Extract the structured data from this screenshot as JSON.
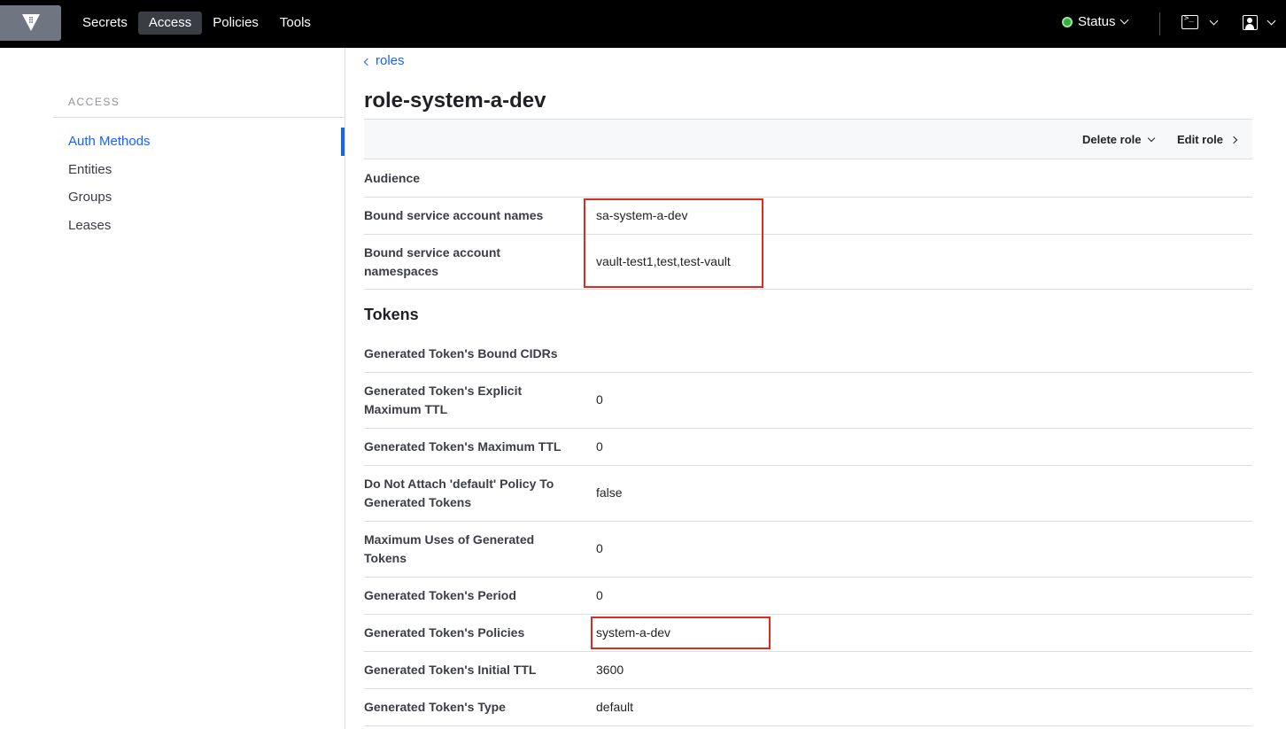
{
  "nav": {
    "links": [
      "Secrets",
      "Access",
      "Policies",
      "Tools"
    ],
    "active": "Access",
    "status_label": "Status"
  },
  "sidebar": {
    "heading": "ACCESS",
    "items": [
      {
        "label": "Auth Methods",
        "active": true
      },
      {
        "label": "Entities",
        "active": false
      },
      {
        "label": "Groups",
        "active": false
      },
      {
        "label": "Leases",
        "active": false
      }
    ]
  },
  "breadcrumb": {
    "label": "roles"
  },
  "page": {
    "title": "role-system-a-dev"
  },
  "toolbar": {
    "delete_label": "Delete role",
    "edit_label": "Edit role"
  },
  "fields": [
    {
      "label": "Audience",
      "value": ""
    },
    {
      "label": "Bound service account names",
      "value": "sa-system-a-dev"
    },
    {
      "label": "Bound service account namespaces",
      "value": "vault-test1,test,test-vault"
    }
  ],
  "tokens": {
    "title": "Tokens",
    "fields": [
      {
        "label": "Generated Token's Bound CIDRs",
        "value": ""
      },
      {
        "label": "Generated Token's Explicit Maximum TTL",
        "value": "0"
      },
      {
        "label": "Generated Token's Maximum TTL",
        "value": "0"
      },
      {
        "label": "Do Not Attach 'default' Policy To Generated Tokens",
        "value": "false"
      },
      {
        "label": "Maximum Uses of Generated Tokens",
        "value": "0"
      },
      {
        "label": "Generated Token's Period",
        "value": "0"
      },
      {
        "label": "Generated Token's Policies",
        "value": "system-a-dev"
      },
      {
        "label": "Generated Token's Initial TTL",
        "value": "3600"
      },
      {
        "label": "Generated Token's Type",
        "value": "default"
      }
    ]
  },
  "colors": {
    "accent": "#1563ff",
    "highlight": "#d92d20",
    "status_ok": "#2eb039"
  }
}
